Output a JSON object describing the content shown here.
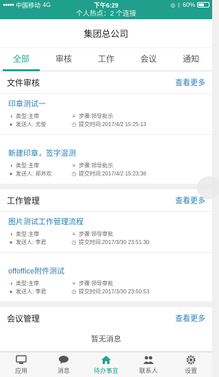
{
  "status": {
    "carrier": "中国移动",
    "network": "4G",
    "time": "下午6:29",
    "battery": "60%",
    "battery_level": 0.6
  },
  "hotspot": "个人热点：2 个连接",
  "header": {
    "title": "集团总公司"
  },
  "tabs": [
    {
      "label": "全部",
      "active": true
    },
    {
      "label": "审核",
      "active": false
    },
    {
      "label": "工作",
      "active": false
    },
    {
      "label": "会议",
      "active": false
    },
    {
      "label": "通知",
      "active": false
    }
  ],
  "sections": {
    "doc": {
      "title": "文件审核",
      "more": "查看更多",
      "items": [
        {
          "title": "印章测试一",
          "type": "类型:主审",
          "step": "步骤:领导批示",
          "sender": "发送人: 尤俊",
          "time": "提交时间:2017/4/2 15:25:13"
        },
        {
          "title": "新建印章，签字混测",
          "type": "类型:主审",
          "step": "步骤:领导批示",
          "sender": "发送人: 郑井欢",
          "time": "提交时间:2017/4/2 15:23:36"
        }
      ]
    },
    "work": {
      "title": "工作管理",
      "more": "查看更多",
      "items": [
        {
          "title": "图片测试工作管理流程",
          "type": "类型:主审",
          "step": "步骤:领导审批",
          "sender": "发送人: 李君",
          "time": "提交时间:2017/3/30 23:51:30"
        },
        {
          "title": "offoffice附件测试",
          "type": "类型:主审",
          "step": "步骤:领导审批",
          "sender": "发送人: 李君",
          "time": "提交时间:2017/3/30 23:50:53"
        }
      ]
    },
    "meeting": {
      "title": "会议管理",
      "more": "查看更多",
      "empty": "暂无消息"
    }
  },
  "tabbar": [
    {
      "label": "应用",
      "icon": "monitor-icon",
      "active": false
    },
    {
      "label": "消息",
      "icon": "chat-bubble-icon",
      "active": false
    },
    {
      "label": "待办事宜",
      "icon": "home-icon",
      "active": true
    },
    {
      "label": "联系人",
      "icon": "contacts-icon",
      "active": false
    },
    {
      "label": "设置",
      "icon": "gear-icon",
      "active": false
    }
  ],
  "colors": {
    "accent": "#21a58e",
    "status_bar": "#1f9f8c",
    "link": "#2b7fb6"
  }
}
